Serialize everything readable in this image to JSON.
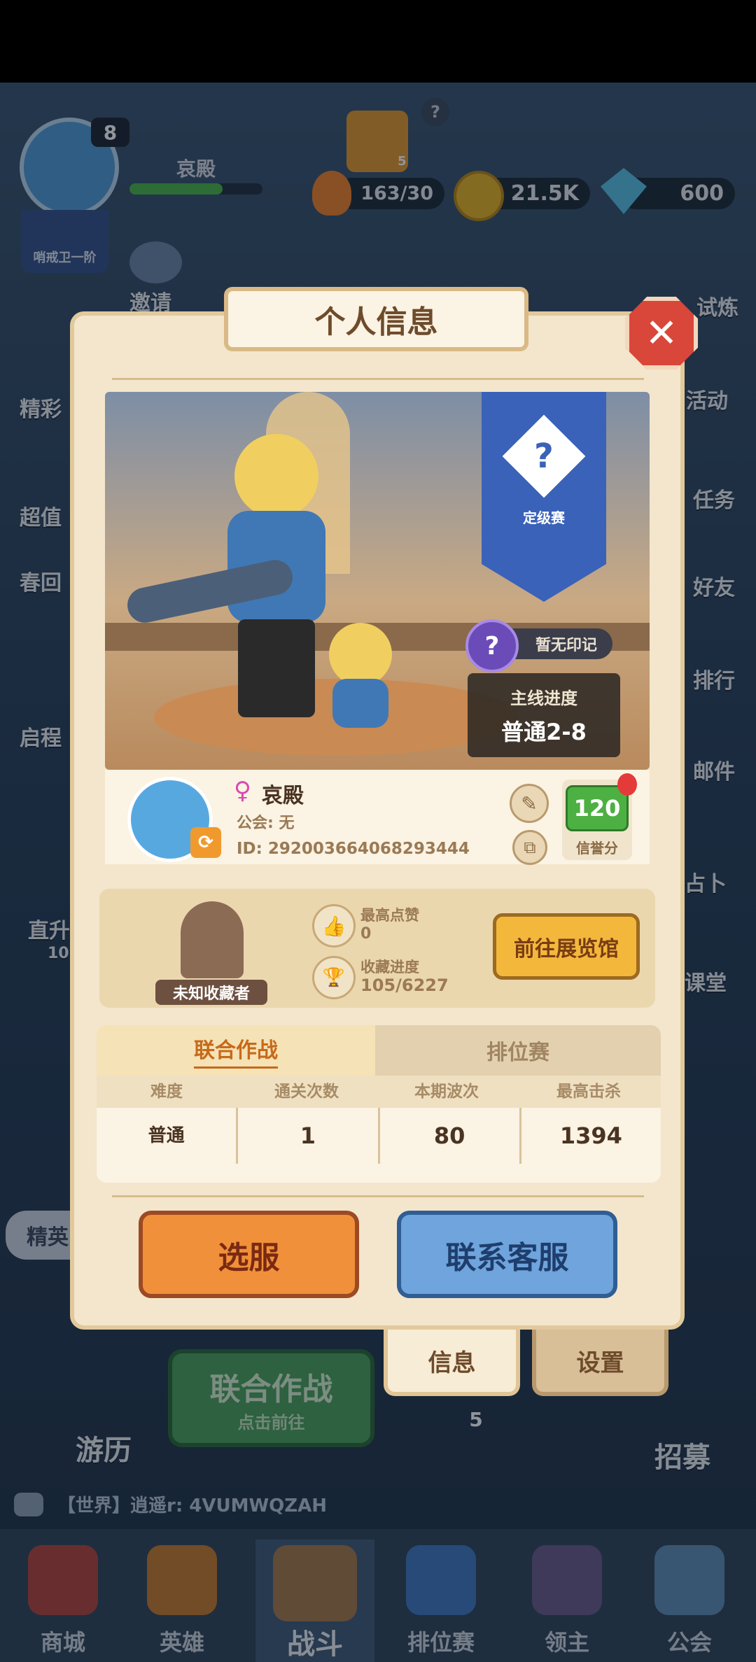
{
  "hud": {
    "level": "8",
    "player_name": "哀殿",
    "rank_badge": "哨戒卫一阶",
    "help": "?",
    "energy": "163/30",
    "gold": "21.5K",
    "gems": "600",
    "crown_count": "5"
  },
  "side_left": [
    "邀请",
    "精彩",
    "超值",
    "春回",
    "启程",
    "直升"
  ],
  "side_left_timer": "10",
  "side_right": [
    "试炼",
    "活动",
    "任务",
    "好友",
    "排行",
    "邮件",
    "占卜",
    "课堂"
  ],
  "lower": {
    "elite": "精英",
    "battle_title": "联合作战",
    "battle_sub": "点击前往",
    "travel": "游历",
    "recruit": "招募",
    "cost": "5",
    "chat": "【世界】逍遥r: 4VUMWQZAH"
  },
  "nav": [
    "商城",
    "英雄",
    "战斗",
    "排位赛",
    "领主",
    "公会"
  ],
  "modal": {
    "title": "个人信息",
    "close": "✕",
    "banner_label": "定级赛",
    "no_mark": "暂无印记",
    "mainline_label": "主线进度",
    "mainline_value": "普通2-8",
    "profile": {
      "name": "哀殿",
      "guild": "公会: 无",
      "id": "ID: 292003664068293444",
      "credit_value": "120",
      "credit_label": "信誉分"
    },
    "collection": {
      "title_badge": "未知收藏者",
      "likes_label": "最高点赞",
      "likes_value": "0",
      "progress_label": "收藏进度",
      "progress_value": "105/6227",
      "gallery_button": "前往展览馆"
    },
    "tabs": [
      "联合作战",
      "排位赛"
    ],
    "table": {
      "headers": [
        "难度",
        "通关次数",
        "本期波次",
        "最高击杀"
      ],
      "rows": [
        [
          "普通",
          "1",
          "80",
          "1394"
        ]
      ]
    },
    "btn_server": "选服",
    "btn_support": "联系客服",
    "bottom_tabs": [
      "信息",
      "设置"
    ]
  },
  "colors": {
    "accent_orange": "#f1903a",
    "accent_blue": "#6fa4dc",
    "parchment": "#f3e6cc",
    "close_red": "#d9463a",
    "banner_blue": "#3a62b8"
  }
}
